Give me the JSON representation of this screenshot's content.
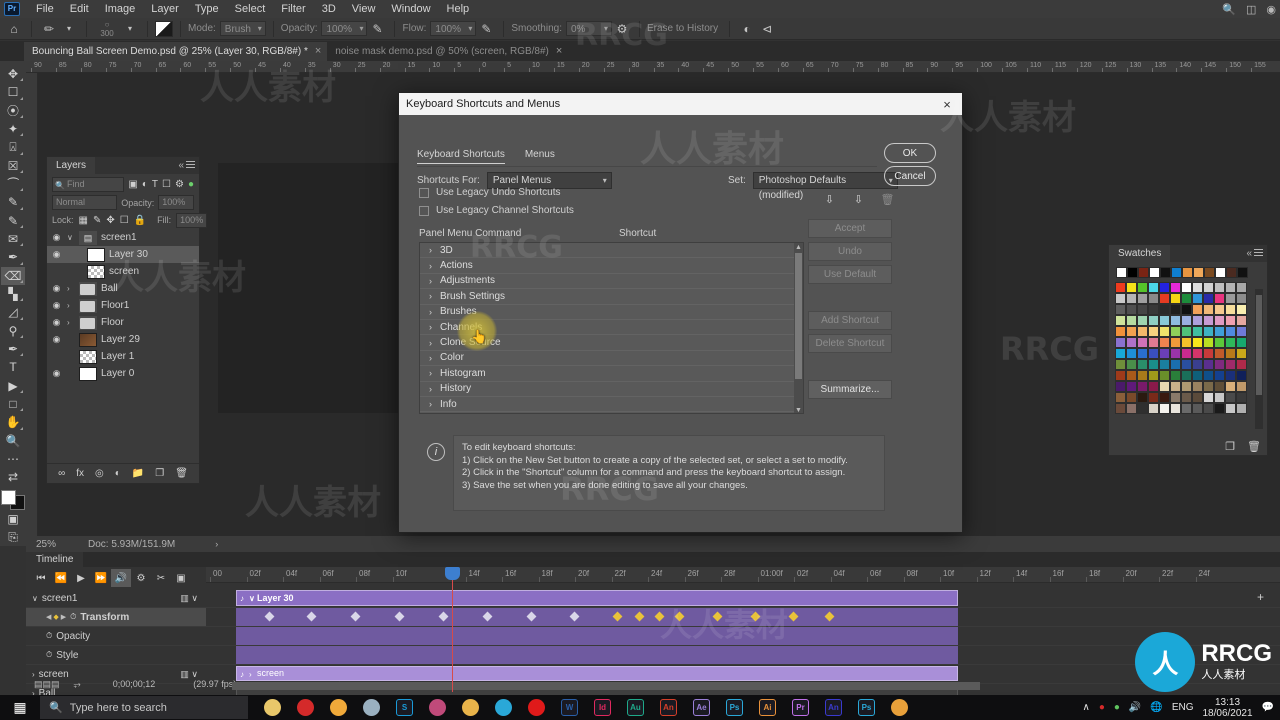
{
  "menubar": {
    "logo": "Pr",
    "items": [
      "File",
      "Edit",
      "Image",
      "Layer",
      "Type",
      "Select",
      "Filter",
      "3D",
      "View",
      "Window",
      "Help"
    ],
    "right_icons": [
      "search-icon",
      "arrange-icon",
      "workspace-icon"
    ]
  },
  "options_bar": {
    "home_icon": "home-icon",
    "brush_preset_size": "300",
    "mode_label": "Mode:",
    "mode_value": "Brush",
    "opacity_label": "Opacity:",
    "opacity_value": "100%",
    "flow_label": "Flow:",
    "flow_value": "100%",
    "smoothing_label": "Smoothing:",
    "smoothing_value": "0%",
    "erase_to_history": "Erase to History"
  },
  "document_tabs": [
    {
      "title": "Bouncing Ball Screen Demo.psd @ 25% (Layer 30, RGB/8#) *",
      "active": true,
      "close": "×"
    },
    {
      "title": "noise mask demo.psd @ 50% (screen, RGB/8#)",
      "active": false,
      "close": "×"
    }
  ],
  "toolbar": {
    "tools": [
      "move-tool",
      "marquee-tool",
      "lasso-tool",
      "quick-select-tool",
      "crop-tool",
      "frame-tool",
      "eyedropper-tool",
      "healing-brush-tool",
      "brush-tool",
      "clone-stamp-tool",
      "history-brush-tool",
      "eraser-tool",
      "gradient-tool",
      "blur-tool",
      "dodge-tool",
      "pen-tool",
      "type-tool",
      "path-select-tool",
      "rectangle-tool",
      "hand-tool",
      "zoom-tool",
      "more-tools",
      "edit-toolbar"
    ],
    "selected_tool": "eraser-tool"
  },
  "rulers": {
    "horizontal_ticks": [
      "90",
      "85",
      "80",
      "75",
      "70",
      "65",
      "60",
      "55",
      "50",
      "45",
      "40",
      "35",
      "30",
      "25",
      "20",
      "15",
      "10",
      "5",
      "0",
      "5",
      "10",
      "15",
      "20",
      "25",
      "30",
      "35",
      "40",
      "45",
      "50",
      "55",
      "60",
      "65",
      "70",
      "75",
      "80",
      "85",
      "90",
      "95",
      "100",
      "105",
      "110",
      "115",
      "120",
      "125",
      "130",
      "135",
      "140",
      "145",
      "150",
      "155"
    ]
  },
  "layers_panel": {
    "tab_label": "Layers",
    "search_placeholder": "Find",
    "filter_icons": [
      "pixel-filter-icon",
      "adjustment-filter-icon",
      "type-filter-icon",
      "shape-filter-icon",
      "smart-filter-icon",
      "filter-toggle-icon"
    ],
    "blend_mode": "Normal",
    "opacity_label": "Opacity:",
    "opacity_value": "100%",
    "lock_label": "Lock:",
    "lock_icons": [
      "lock-transparent-icon",
      "lock-image-icon",
      "lock-position-icon",
      "lock-nesting-icon",
      "lock-all-icon"
    ],
    "fill_label": "Fill:",
    "fill_value": "100%",
    "layers": [
      {
        "name": "screen1",
        "visible": true,
        "type": "group-video",
        "selected": false,
        "indent": 0,
        "twisty": "∨"
      },
      {
        "name": "Layer 30",
        "visible": true,
        "type": "layer-mask",
        "selected": true,
        "indent": 1,
        "twisty": ""
      },
      {
        "name": "screen",
        "visible": false,
        "type": "checker-mask",
        "selected": false,
        "indent": 1,
        "twisty": ""
      },
      {
        "name": "Ball",
        "visible": true,
        "type": "folder",
        "selected": false,
        "indent": 0,
        "twisty": "›"
      },
      {
        "name": "Floor1",
        "visible": true,
        "type": "folder",
        "selected": false,
        "indent": 0,
        "twisty": "›"
      },
      {
        "name": "Floor",
        "visible": true,
        "type": "folder",
        "selected": false,
        "indent": 0,
        "twisty": "›"
      },
      {
        "name": "Layer 29",
        "visible": true,
        "type": "brown",
        "selected": false,
        "indent": 0,
        "twisty": ""
      },
      {
        "name": "Layer 1",
        "visible": false,
        "type": "checker",
        "selected": false,
        "indent": 0,
        "twisty": ""
      },
      {
        "name": "Layer 0",
        "visible": true,
        "type": "white",
        "selected": false,
        "indent": 0,
        "twisty": ""
      }
    ],
    "footer_icons": [
      "link-icon",
      "fx-icon",
      "mask-icon",
      "adjustment-icon",
      "group-icon",
      "new-layer-icon",
      "delete-icon"
    ]
  },
  "swatches_panel": {
    "tab_label": "Swatches",
    "recent": [
      "#ffffff",
      "#000000",
      "#7a2414",
      "#ffffff",
      "#111111",
      "#0f7fd0",
      "#e89540",
      "#f0a85a",
      "#7a4a20",
      "#ffffff",
      "#4a2a20",
      "#111111"
    ],
    "grid": [
      "#ef3b1e",
      "#f5e119",
      "#55c42a",
      "#4bd8e8",
      "#2323e0",
      "#e829d8",
      "#ffffff",
      "#dcdcdc",
      "#d2d2d2",
      "#c0c0c0",
      "#b4b4b4",
      "#a8a8a8",
      "#c9c9c9",
      "#b5b5b5",
      "#a0a0a0",
      "#8a8a8a",
      "#e53b22",
      "#f5d515",
      "#1d8c3b",
      "#2f95d8",
      "#2a2aa8",
      "#e8357f",
      "#9a9a9a",
      "#8c8c8c",
      "#5e5e5e",
      "#4f4f4f",
      "#454545",
      "#383838",
      "#2a2a2a",
      "#1e1e1e",
      "#101010",
      "#f2a25a",
      "#f0b878",
      "#f5c98e",
      "#f7de9b",
      "#f9eeb0",
      "#cfe39b",
      "#b6dba0",
      "#9fd4b0",
      "#8fcfc4",
      "#88c9d8",
      "#8fbce0",
      "#9aaee0",
      "#ae9fdc",
      "#c79bd4",
      "#e09bc4",
      "#f0a0b0",
      "#e6a8a0",
      "#f0913a",
      "#f2a24f",
      "#f4b86a",
      "#f7d27f",
      "#efe26b",
      "#8fd05a",
      "#4fc27a",
      "#3fbfa0",
      "#3eb2c4",
      "#3f9fd8",
      "#4f8ae0",
      "#6f7ad8",
      "#8a72d0",
      "#b072c8",
      "#d072b8",
      "#e07a92",
      "#ef8450",
      "#f09a3a",
      "#f4c12a",
      "#f7e71c",
      "#b9e022",
      "#5cc83a",
      "#2fb85a",
      "#17a86e",
      "#18a8d8",
      "#1e8fd8",
      "#2a6fd0",
      "#3a4fc0",
      "#6a3fb8",
      "#9a34a8",
      "#c82a90",
      "#d4356a",
      "#c83a3a",
      "#c05a2a",
      "#b87a1a",
      "#c9a81a",
      "#6f8f3a",
      "#4a8f4a",
      "#2a8f6a",
      "#1a8f8a",
      "#1a7f9f",
      "#1a6faf",
      "#2a4f9f",
      "#3a3f8f",
      "#5a2f8f",
      "#7f2a7f",
      "#9f2a6a",
      "#af2a4a",
      "#9f3a1a",
      "#a85a1a",
      "#a87a1a",
      "#9f9a1a",
      "#6a8f2a",
      "#2a7f3a",
      "#1a6f5a",
      "#0f5f7a",
      "#0f4f8a",
      "#14408f",
      "#1a2f7a",
      "#10205a",
      "#4a1a6a",
      "#5f1a7a",
      "#7a1a6a",
      "#8a1a4a",
      "#e8d8b0",
      "#c8b08a",
      "#b09a72",
      "#9a8260",
      "#7a6a4a",
      "#5f4f38",
      "#d8b07a",
      "#c09a6a",
      "#8a5f3a",
      "#7a4a2a",
      "#2a1a10",
      "#7a2a1a",
      "#3a1a0f",
      "#8a7a6a",
      "#6a5a4a",
      "#5a4a3a",
      "#d8d8d8",
      "#c8c8c8",
      "#4a4a4a",
      "#3a3a3a",
      "#6a4a3a",
      "#8a7068",
      "#2f2f2f",
      "#d8d2c8",
      "#f5f3ee",
      "#e8e4dc",
      "#6a6a6a",
      "#5a5a5a",
      "#4a4a4a",
      "#1a1a1a",
      "#c8c8c8",
      "#b0b0b0"
    ],
    "footer_icons": [
      "new-swatch-icon",
      "delete-swatch-icon"
    ]
  },
  "status_bar": {
    "zoom": "25%",
    "doc_info": "Doc: 5.93M/151.9M",
    "arrow": "›"
  },
  "timeline": {
    "tab_label": "Timeline",
    "transport": [
      "go-to-first-frame-icon",
      "previous-frame-icon",
      "play-icon",
      "next-frame-icon",
      "audio-icon",
      "gear-icon",
      "scissors-icon",
      "render-icon"
    ],
    "ruler_ticks": [
      "00",
      "02f",
      "04f",
      "06f",
      "08f",
      "10f",
      "14f",
      "16f",
      "18f",
      "20f",
      "22f",
      "24f",
      "26f",
      "28f",
      "01:00f",
      "02f",
      "04f",
      "06f",
      "08f",
      "10f",
      "12f",
      "14f",
      "16f",
      "18f",
      "20f",
      "22f",
      "24f"
    ],
    "rows": [
      {
        "name": "screen1",
        "indent": 0,
        "twisty": "∨",
        "track": "layer30",
        "bar_label": "Layer 30",
        "selected": false
      },
      {
        "name": "Transform",
        "indent": 1,
        "twisty": "",
        "track": "keyframes",
        "selected": true
      },
      {
        "name": "Opacity",
        "indent": 1,
        "twisty": "",
        "track": "empty",
        "selected": false
      },
      {
        "name": "Style",
        "indent": 1,
        "twisty": "",
        "track": "empty",
        "selected": false
      },
      {
        "name": "screen",
        "indent": 0,
        "twisty": "›",
        "track": "screen",
        "bar_label": "screen",
        "selected": false
      },
      {
        "name": "Ball",
        "indent": 0,
        "twisty": "›",
        "track": "ball",
        "selected": false
      }
    ],
    "keyframes_x": [
      30,
      72,
      116,
      160,
      204,
      248,
      292,
      335,
      378,
      420
    ],
    "timecode": "0;00;00;12",
    "fps": "(29.97 fps)",
    "add_media_icon": "add-media-icon"
  },
  "dialog": {
    "title": "Keyboard Shortcuts and Menus",
    "close_icon": "×",
    "tabs": [
      {
        "label": "Keyboard Shortcuts",
        "active": true
      },
      {
        "label": "Menus",
        "active": false
      }
    ],
    "shortcuts_for_label": "Shortcuts For:",
    "shortcuts_for_value": "Panel Menus",
    "set_label": "Set:",
    "set_value": "Photoshop Defaults (modified)",
    "checkboxes": [
      {
        "label": "Use Legacy Undo Shortcuts",
        "checked": false
      },
      {
        "label": "Use Legacy Channel Shortcuts",
        "checked": false
      }
    ],
    "set_icons": [
      "save-set-icon",
      "save-set-as-icon",
      "delete-set-icon"
    ],
    "columns": {
      "command": "Panel Menu Command",
      "shortcut": "Shortcut"
    },
    "list_items": [
      "3D",
      "Actions",
      "Adjustments",
      "Brush Settings",
      "Brushes",
      "Channels",
      "Clone Source",
      "Color",
      "Histogram",
      "History",
      "Info"
    ],
    "list_chevron": "›",
    "buttons": {
      "ok": "OK",
      "cancel": "Cancel",
      "accept": "Accept",
      "undo": "Undo",
      "use_default": "Use Default",
      "add_shortcut": "Add Shortcut",
      "delete_shortcut": "Delete Shortcut",
      "summarize": "Summarize..."
    },
    "info_icon": "i",
    "info_lines": [
      "To edit keyboard shortcuts:",
      "1) Click on the New Set button to create a copy of the selected set, or select a set to modify.",
      "2) Click in the \"Shortcut\" column for a command and press the keyboard shortcut to assign.",
      "3) Save the set when you are done editing to save all your changes."
    ]
  },
  "taskbar": {
    "start_icon": "windows-start-icon",
    "search_placeholder": "Type here to search",
    "search_icon": "search-icon",
    "apps": [
      {
        "name": "sticky-notes-icon",
        "label": "",
        "color": "#e8c76a"
      },
      {
        "name": "record-icon",
        "label": "",
        "color": "#d42a2a"
      },
      {
        "name": "weather-icon",
        "label": "",
        "color": "#f0a93a"
      },
      {
        "name": "monitor-icon",
        "label": "",
        "color": "#9ab0c0"
      },
      {
        "name": "skype-icon",
        "label": "S",
        "color": "#1a9ad8"
      },
      {
        "name": "snip-icon",
        "label": "",
        "color": "#c04a7a"
      },
      {
        "name": "file-explorer-icon",
        "label": "",
        "color": "#e8b34a"
      },
      {
        "name": "edge-icon",
        "label": "",
        "color": "#2aa8d8"
      },
      {
        "name": "opera-icon",
        "label": "",
        "color": "#e01a1a"
      },
      {
        "name": "word-icon",
        "label": "W",
        "color": "#2a5fa8"
      },
      {
        "name": "indesign-icon",
        "label": "Id",
        "color": "#e0295f"
      },
      {
        "name": "audition-icon",
        "label": "Au",
        "color": "#1fa98a"
      },
      {
        "name": "animate-icon",
        "label": "An",
        "color": "#d43f2a"
      },
      {
        "name": "after-effects-icon",
        "label": "Ae",
        "color": "#9a7fd8"
      },
      {
        "name": "photoshop-icon",
        "label": "Ps",
        "color": "#2aa8d8"
      },
      {
        "name": "illustrator-icon",
        "label": "Ai",
        "color": "#e8913a"
      },
      {
        "name": "premiere-icon",
        "label": "Pr",
        "color": "#c070e8"
      },
      {
        "name": "animate2-icon",
        "label": "An",
        "color": "#3a3acf"
      },
      {
        "name": "photoshop2-icon",
        "label": "Ps",
        "color": "#2aa8d8"
      },
      {
        "name": "creative-cloud-icon",
        "label": "",
        "color": "#e8a03a"
      }
    ],
    "tray": {
      "chevron": "∧",
      "icons": [
        "record-tray-icon",
        "shield-tray-icon",
        "volume-tray-icon",
        "network-tray-icon"
      ],
      "language": "ENG",
      "time": "13:13",
      "date": "18/06/2021",
      "notification_icon": "notification-icon"
    }
  },
  "watermark": {
    "text": "RRCG",
    "cn_text": "人人素材",
    "logo_text": "RRCG",
    "logo_sub": "人人素材",
    "logo_glyph": "人"
  }
}
